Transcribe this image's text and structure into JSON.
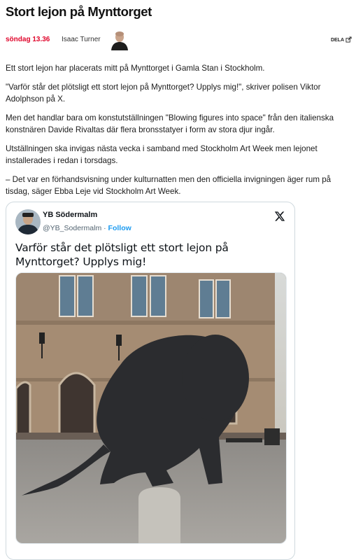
{
  "article": {
    "headline": "Stort lejon på Mynttorget",
    "published": "söndag 13.36",
    "author": "Isaac Turner",
    "share_label": "DELA",
    "paragraphs": [
      "Ett stort lejon har placerats mitt på Mynttorget i Gamla Stan i Stockholm.",
      "\"Varför står det plötsligt ett stort lejon på Mynttorget? Upplys mig!\", skriver polisen Viktor Adolphson på X.",
      "Men det handlar bara om konstutställningen \"Blowing figures into space\" från den italienska konstnären Davide Rivaltas där flera bronsstatyer i form av stora djur ingår.",
      "Utställningen ska invigas nästa vecka i samband med Stockholm Art Week men lejonet installerades i redan i torsdags.",
      "– Det var en förhandsvisning under kulturnatten men den officiella invigningen äger rum på tisdag, säger Ebba Leje vid Stockholm Art Week."
    ]
  },
  "tweet": {
    "display_name": "YB Södermalm",
    "handle": "@YB_Sodermalm",
    "separator": "·",
    "follow_label": "Follow",
    "text": "Varför står det plötsligt ett stort  lejon på Mynttorget? Upplys mig!",
    "photo_icon": "lion-statue-photo"
  },
  "colors": {
    "accent_red": "#e0052b",
    "link_blue": "#1d9bf0",
    "text_dark": "#0f1419",
    "text_muted": "#536471",
    "card_border": "#cfd9de"
  },
  "icons": {
    "share": "share-icon",
    "x_logo": "x-logo-icon"
  }
}
